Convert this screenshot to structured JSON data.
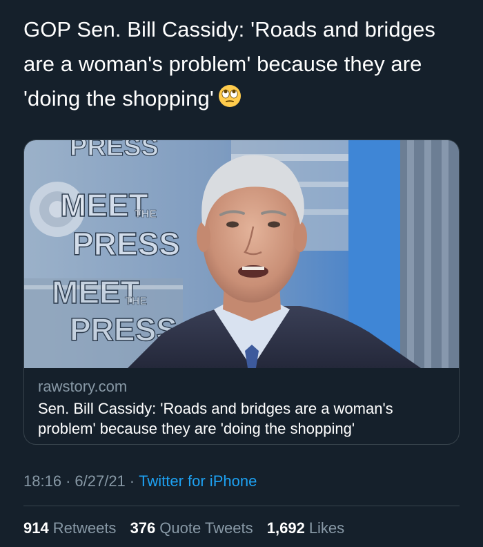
{
  "tweet": {
    "text": "GOP Sen. Bill Cassidy: 'Roads and bridges are a woman's problem' because they are 'doing the shopping'",
    "emoji": "face-with-rolling-eyes"
  },
  "link_card": {
    "domain": "rawstory.com",
    "title": "Sen. Bill Cassidy: 'Roads and bridges are a woman's problem' because they are 'doing the shopping'",
    "image_texts": {
      "top_press": "PRESS",
      "meet": "MEET",
      "the": "THE",
      "press": "PRESS",
      "meet2": "MEET",
      "the2": "THE",
      "press2": "PRESS"
    }
  },
  "meta": {
    "time": "18:16",
    "date": "6/27/21",
    "separator": "·",
    "source": "Twitter for iPhone"
  },
  "stats": {
    "retweets_count": "914",
    "retweets_label": "Retweets",
    "quotes_count": "376",
    "quotes_label": "Quote Tweets",
    "likes_count": "1,692",
    "likes_label": "Likes"
  },
  "colors": {
    "background": "#15202b",
    "text": "#ffffff",
    "secondary": "#8899a6",
    "link": "#1da1f2",
    "border": "#38444d"
  }
}
